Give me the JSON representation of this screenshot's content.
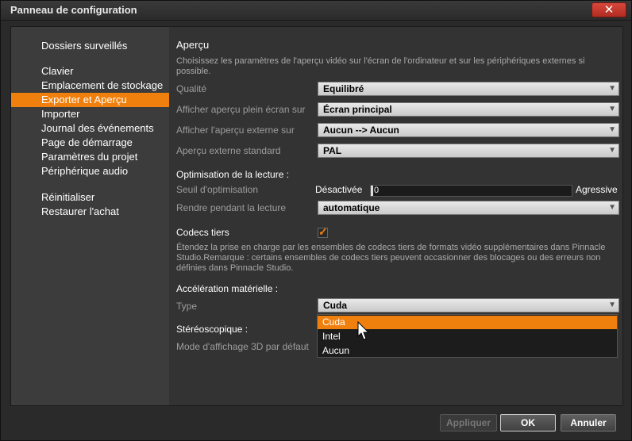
{
  "window": {
    "title": "Panneau de configuration",
    "close_label": "✕"
  },
  "sidebar": {
    "items": [
      {
        "label": "Dossiers surveillés",
        "active": false
      },
      {
        "label": "Clavier",
        "active": false
      },
      {
        "label": "Emplacement de stockage",
        "active": false
      },
      {
        "label": "Exporter et Aperçu",
        "active": true
      },
      {
        "label": "Importer",
        "active": false
      },
      {
        "label": "Journal des événements",
        "active": false
      },
      {
        "label": "Page de démarrage",
        "active": false
      },
      {
        "label": "Paramètres du projet",
        "active": false
      },
      {
        "label": "Périphérique audio",
        "active": false
      },
      {
        "label": "Réinitialiser",
        "active": false
      },
      {
        "label": "Restaurer l'achat",
        "active": false
      }
    ]
  },
  "main": {
    "preview_title": "Aperçu",
    "preview_desc": "Choisissez les paramètres de l'aperçu vidéo sur l'écran de l'ordinateur et sur les périphériques externes si possible.",
    "quality_label": "Qualité",
    "quality_value": "Equilibré",
    "fullscreen_label": "Afficher aperçu plein écran sur",
    "fullscreen_value": "Écran principal",
    "external_label": "Afficher l'aperçu externe sur",
    "external_value": "Aucun --> Aucun",
    "standard_label": "Aperçu externe standard",
    "standard_value": "PAL",
    "optim_title": "Optimisation de la lecture :",
    "threshold_label": "Seuil d'optimisation",
    "threshold_min": "Désactivée",
    "threshold_value": "0",
    "threshold_max": "Agressive",
    "render_label": "Rendre pendant la lecture",
    "render_value": "automatique",
    "codecs_title": "Codecs tiers",
    "codecs_checked": true,
    "codecs_desc": "Étendez la prise en charge par les ensembles de codecs tiers de formats vidéo supplémentaires dans Pinnacle Studio.Remarque : certains ensembles de codecs tiers peuvent occasionner des blocages ou des erreurs non définies dans Pinnacle Studio.",
    "accel_title": "Accélération matérielle :",
    "type_label": "Type",
    "type_value": "Cuda",
    "type_options": [
      "Cuda",
      "Intel",
      "Aucun"
    ],
    "stereo_title": "Stéréoscopique :",
    "mode3d_label": "Mode d'affichage 3D par défaut"
  },
  "footer": {
    "apply_label": "Appliquer",
    "ok_label": "OK",
    "cancel_label": "Annuler"
  },
  "icons": {
    "dropdown_arrow": "▼",
    "check": "✓"
  },
  "colors": {
    "accent": "#f0800e"
  }
}
